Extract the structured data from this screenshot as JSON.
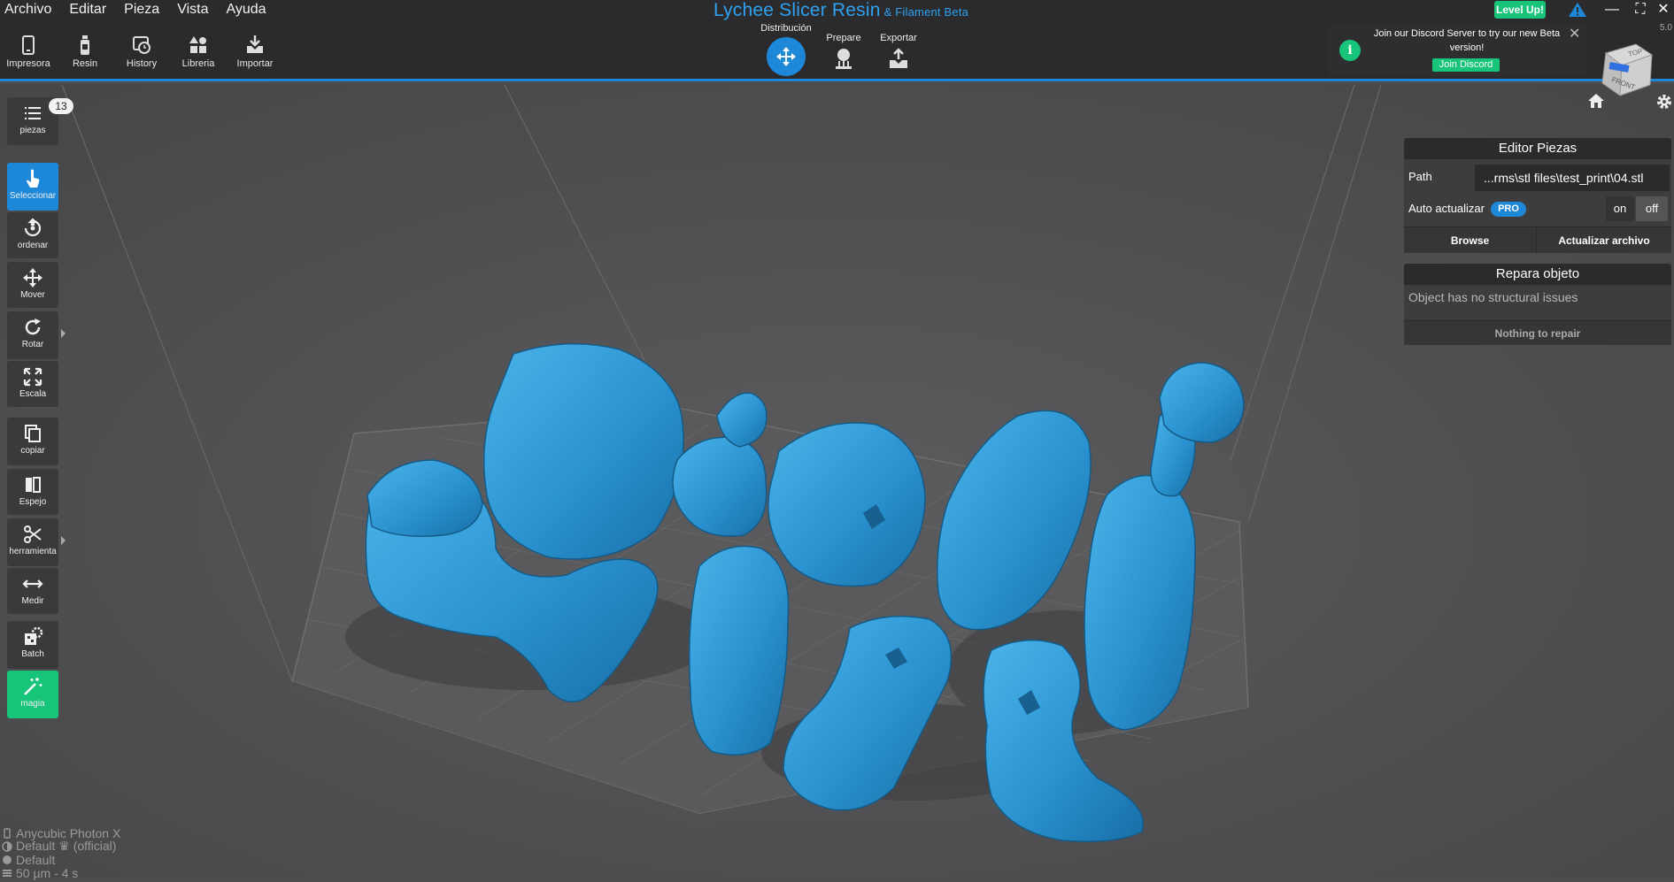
{
  "menu": [
    "Archivo",
    "Editar",
    "Pieza",
    "Vista",
    "Ayuda"
  ],
  "app_title": "Lychee Slicer Resin",
  "app_subtitle": "& Filament Beta",
  "level_up": "Level Up!",
  "version": "5.0",
  "toolbar": [
    {
      "label": "Impresora",
      "icon": "printer-icon"
    },
    {
      "label": "Resin",
      "icon": "resin-bottle-icon"
    },
    {
      "label": "History",
      "icon": "history-icon"
    },
    {
      "label": "Libreria",
      "icon": "library-icon"
    },
    {
      "label": "Importar",
      "icon": "import-icon"
    }
  ],
  "modes": {
    "distribucion": "Distribución",
    "prepare": "Prepare",
    "exportar": "Exportar"
  },
  "discord": {
    "message": "Join our Discord Server to try our new Beta version!",
    "button": "Join Discord"
  },
  "viewcube": {
    "top": "TOP",
    "front": "FRONT"
  },
  "sidebar": {
    "pieces_count": "13",
    "items": [
      {
        "label": "piezas",
        "icon": "list-icon"
      },
      {
        "label": "Seleccionar",
        "icon": "select-hand-icon"
      },
      {
        "label": "ordenar",
        "icon": "arrange-icon"
      },
      {
        "label": "Mover",
        "icon": "move-icon"
      },
      {
        "label": "Rotar",
        "icon": "rotate-icon"
      },
      {
        "label": "Escala",
        "icon": "scale-icon"
      },
      {
        "label": "copiar",
        "icon": "copy-icon"
      },
      {
        "label": "Espejo",
        "icon": "mirror-icon"
      },
      {
        "label": "herramienta",
        "icon": "scissors-icon"
      },
      {
        "label": "Medir",
        "icon": "measure-icon"
      },
      {
        "label": "Batch",
        "icon": "batch-icon"
      },
      {
        "label": "magia",
        "icon": "magic-wand-icon"
      }
    ]
  },
  "editor": {
    "title": "Editor Piezas",
    "path_label": "Path",
    "path_value": "...rms\\stl files\\test_print\\04.stl",
    "auto_label": "Auto actualizar",
    "pro": "PRO",
    "on": "on",
    "off": "off",
    "browse": "Browse",
    "update": "Actualizar archivo"
  },
  "repair": {
    "title": "Repara objeto",
    "message": "Object has no structural issues",
    "button": "Nothing to repair"
  },
  "status": {
    "printer": "Anycubic Photon X",
    "profile": "Default ♛ (official)",
    "resin": "Default",
    "layer": "50 µm - 4 s"
  },
  "colors": {
    "accent": "#1e88d8",
    "green": "#18c47a",
    "model": "#2e9ad4"
  }
}
